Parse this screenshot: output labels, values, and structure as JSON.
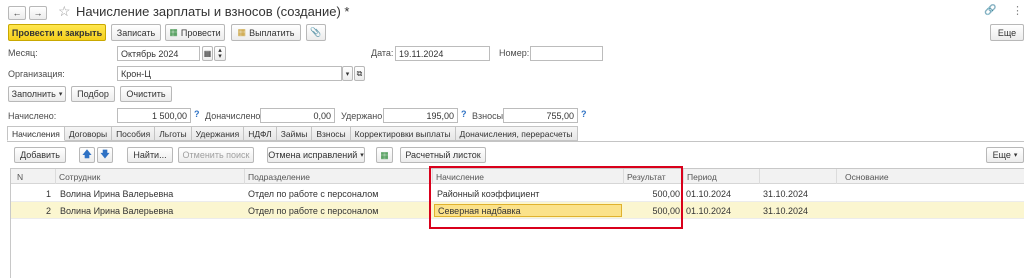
{
  "window": {
    "title": "Начисление зарплаты и взносов (создание) *"
  },
  "toolbar": {
    "post_close": "Провести и закрыть",
    "save": "Записать",
    "post": "Провести",
    "pay": "Выплатить",
    "more": "Еще"
  },
  "form": {
    "month_label": "Месяц:",
    "month_value": "Октябрь 2024",
    "date_label": "Дата:",
    "date_value": "19.11.2024",
    "number_label": "Номер:",
    "number_value": "",
    "org_label": "Организация:",
    "org_value": "Крон-Ц"
  },
  "actions": {
    "fill": "Заполнить",
    "select": "Подбор",
    "clear": "Очистить"
  },
  "totals": {
    "accrued_label": "Начислено:",
    "accrued_value": "1 500,00",
    "extra_label": "Доначислено:",
    "extra_value": "0,00",
    "withheld_label": "Удержано:",
    "withheld_value": "195,00",
    "contrib_label": "Взносы:",
    "contrib_value": "755,00",
    "help_mark": "?"
  },
  "tabs": [
    "Начисления",
    "Договоры",
    "Пособия",
    "Льготы",
    "Удержания",
    "НДФЛ",
    "Займы",
    "Взносы",
    "Корректировки выплаты",
    "Доначисления, перерасчеты"
  ],
  "table_toolbar": {
    "add": "Добавить",
    "find": "Найти...",
    "cancel_search": "Отменить поиск",
    "undo_fixes": "Отмена исправлений",
    "payslip": "Расчетный листок",
    "more": "Еще"
  },
  "table": {
    "columns": [
      "N",
      "Сотрудник",
      "Подразделение",
      "Начисление",
      "Результат",
      "Период",
      "",
      "Основание"
    ],
    "rows": [
      {
        "n": "1",
        "employee": "Волина Ирина Валерьевна",
        "dept": "Отдел по работе с персоналом",
        "accrual": "Районный коэффициент",
        "result": "500,00",
        "from": "01.10.2024",
        "to": "31.10.2024",
        "basis": ""
      },
      {
        "n": "2",
        "employee": "Волина Ирина Валерьевна",
        "dept": "Отдел по работе с персоналом",
        "accrual": "Северная надбавка",
        "result": "500,00",
        "from": "01.10.2024",
        "to": "31.10.2024",
        "basis": ""
      }
    ]
  },
  "colors": {
    "primary_button": "#f5cf1c",
    "highlight_frame": "#d9001b",
    "selected_row": "#fbf6d0",
    "active_cell": "#fbe28a"
  }
}
